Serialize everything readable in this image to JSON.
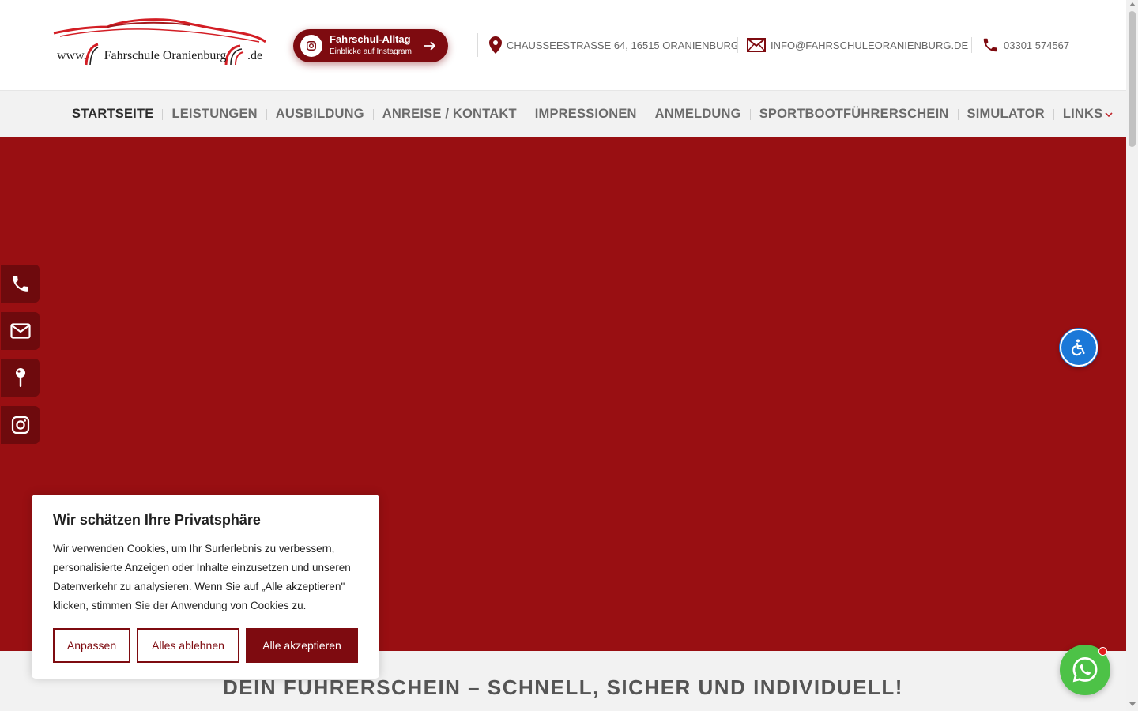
{
  "header": {
    "logo": {
      "prefix": "www.",
      "name": "Fahrschule Oranienburg",
      "suffix": ".de"
    },
    "instagram_button": {
      "title": "Fahrschul-Alltag",
      "subtitle": "Einblicke auf Instagram",
      "icon": "instagram-icon",
      "arrow_icon": "arrow-right-icon"
    },
    "address": {
      "icon": "map-pin-icon",
      "text": "CHAUSSEESTRASSE 64, 16515 ORANIENBURG"
    },
    "email": {
      "icon": "envelope-icon",
      "text": "INFO@FAHRSCHULEORANIENBURG.DE"
    },
    "phone": {
      "icon": "phone-icon",
      "text": "03301 574567"
    }
  },
  "nav": {
    "items": [
      {
        "label": "STARTSEITE",
        "active": true
      },
      {
        "label": "LEISTUNGEN"
      },
      {
        "label": "AUSBILDUNG"
      },
      {
        "label": "ANREISE / KONTAKT"
      },
      {
        "label": "IMPRESSIONEN"
      },
      {
        "label": "ANMELDUNG"
      },
      {
        "label": "SPORTBOOTFÜHRERSCHEIN"
      },
      {
        "label": "SIMULATOR"
      },
      {
        "label": "LINKS",
        "dropdown": true
      }
    ]
  },
  "sidebar": {
    "items": [
      {
        "icon": "phone-icon"
      },
      {
        "icon": "envelope-icon"
      },
      {
        "icon": "map-pin-icon"
      },
      {
        "icon": "instagram-icon"
      }
    ]
  },
  "accessibility": {
    "icon": "wheelchair-icon"
  },
  "section": {
    "headline": "DEIN FÜHRERSCHEIN – SCHNELL, SICHER UND INDIVIDUELL!"
  },
  "cookie": {
    "title": "Wir schätzen Ihre Privatsphäre",
    "text": "Wir verwenden Cookies, um Ihr Surferlebnis zu verbessern, personalisierte Anzeigen oder Inhalte einzusetzen und unseren Datenverkehr zu analysieren. Wenn Sie auf „Alle akzeptieren\" klicken, stimmen Sie der Anwendung von Cookies zu.",
    "buttons": {
      "customize": "Anpassen",
      "reject": "Alles ablehnen",
      "accept": "Alle akzeptieren"
    }
  },
  "whatsapp": {
    "icon": "whatsapp-icon"
  },
  "colors": {
    "brand_dark": "#7e0b10",
    "hero_red": "#990f12",
    "accessibility_blue": "#1b78d8",
    "whatsapp_green": "#4dc247"
  }
}
